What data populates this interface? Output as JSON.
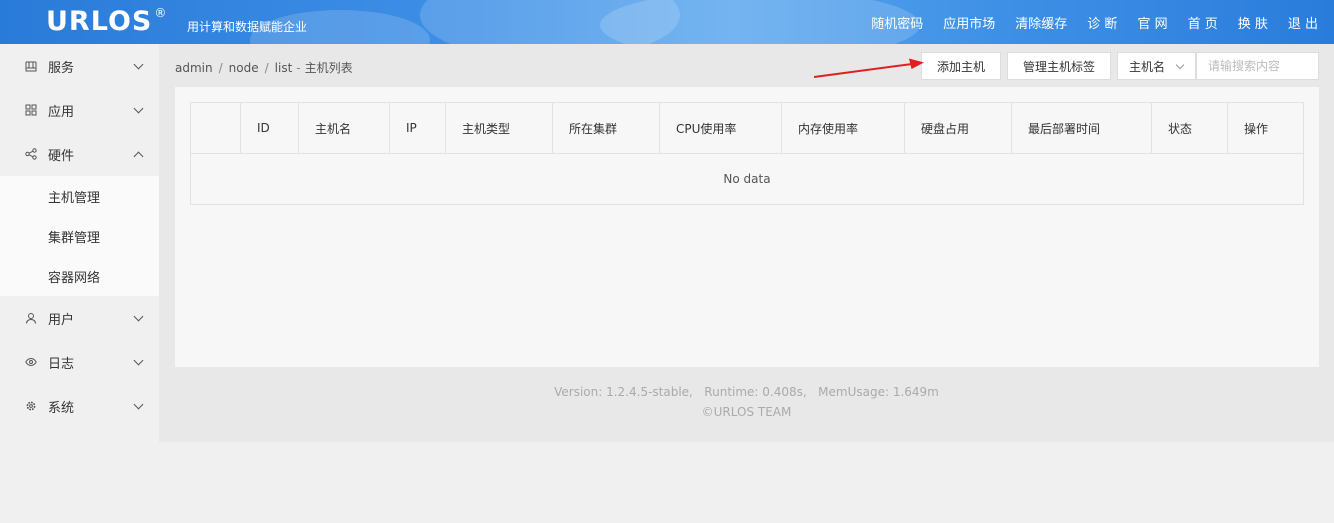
{
  "header": {
    "logo_text": "URLOS",
    "logo_mark": "®",
    "slogan": "用计算和数据赋能企业",
    "nav": [
      "随机密码",
      "应用市场",
      "清除缓存",
      "诊 断",
      "官 网",
      "首 页",
      "换 肤",
      "退 出"
    ]
  },
  "sidebar": {
    "items": [
      {
        "label": "服务",
        "icon": "service-icon",
        "expanded": false
      },
      {
        "label": "应用",
        "icon": "apps-grid-icon",
        "expanded": false
      },
      {
        "label": "硬件",
        "icon": "share-nodes-icon",
        "expanded": true,
        "children": [
          "主机管理",
          "集群管理",
          "容器网络"
        ]
      },
      {
        "label": "用户",
        "icon": "user-icon",
        "expanded": false
      },
      {
        "label": "日志",
        "icon": "eye-icon",
        "expanded": false
      },
      {
        "label": "系统",
        "icon": "gear-icon",
        "expanded": false
      }
    ]
  },
  "breadcrumb": {
    "parts": [
      "admin",
      "node",
      "list"
    ],
    "title": "主机列表"
  },
  "toolbar": {
    "add_host": "添加主机",
    "manage_tags": "管理主机标签",
    "search_field": "主机名",
    "search_placeholder": "请输搜索内容"
  },
  "table": {
    "columns": [
      "",
      "ID",
      "主机名",
      "IP",
      "主机类型",
      "所在集群",
      "CPU使用率",
      "内存使用率",
      "硬盘占用",
      "最后部署时间",
      "状态",
      "操作"
    ],
    "empty_text": "No data"
  },
  "footer": {
    "line1": "Version: 1.2.4.5-stable,   Runtime: 0.408s,   MemUsage: 1.649m",
    "line2": "©URLOS TEAM"
  },
  "colors": {
    "header_blue": "#3d8fe6",
    "annotation_red": "#e02020"
  }
}
